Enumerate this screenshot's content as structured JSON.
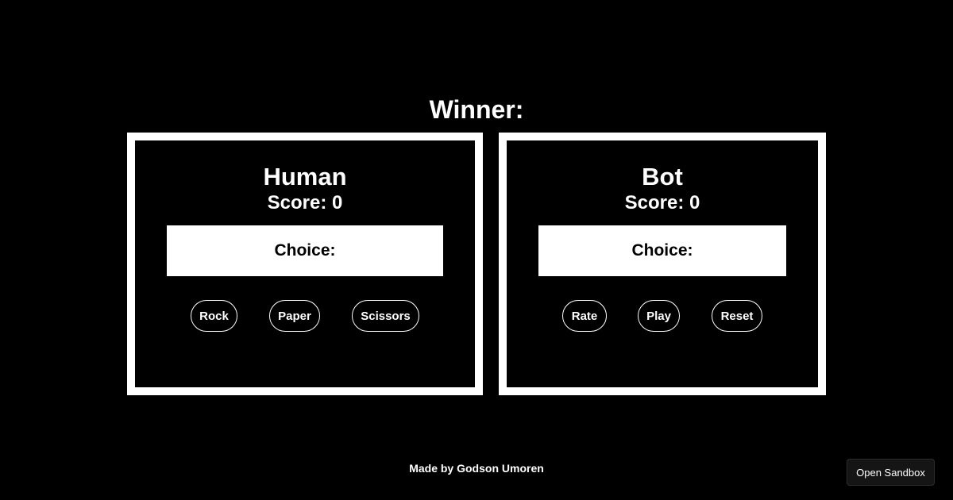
{
  "header": {
    "winner_label": "Winner:"
  },
  "human": {
    "name": "Human",
    "score": "Score: 0",
    "choice": "Choice:",
    "buttons": [
      "Rock",
      "Paper",
      "Scissors"
    ]
  },
  "bot": {
    "name": "Bot",
    "score": "Score: 0",
    "choice": "Choice:",
    "buttons": [
      "Rate",
      "Play",
      "Reset"
    ]
  },
  "footer": {
    "credit": "Made by Godson Umoren"
  },
  "sandbox": {
    "label": "Open Sandbox"
  },
  "colors": {
    "background": "#000000",
    "foreground": "#ffffff"
  }
}
